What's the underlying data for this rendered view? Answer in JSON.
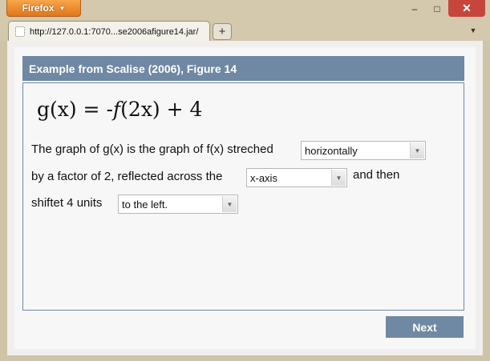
{
  "browser": {
    "app_button_label": "Firefox",
    "tab_title": "http://127.0.0.1:7070...se2006afigure14.jar/",
    "new_tab_label": "+",
    "window_controls": {
      "minimize": "–",
      "maximize": "□",
      "close": "✕"
    }
  },
  "exercise": {
    "title": "Example from Scalise (2006), Figure 14",
    "formula": {
      "lhs": "g(x) = -",
      "func": "f",
      "rhs": "(2x) + 4"
    },
    "sentence_1": "The graph of g(x) is the graph of f(x) streched",
    "select_1": "horizontally",
    "sentence_2": "by a factor of 2, reflected across the",
    "select_2": "x-axis",
    "sentence_3": "and then",
    "sentence_4": "shiftet 4 units",
    "select_3": "to the left.",
    "next_label": "Next"
  },
  "colors": {
    "accent": "#6f88a3",
    "firefox_orange": "#e1761a",
    "close_red": "#c7463c"
  },
  "icons": [
    "dropdown-caret-icon",
    "page-icon",
    "new-tab-icon",
    "tabs-menu-icon",
    "minimize-icon",
    "maximize-icon",
    "close-icon"
  ]
}
